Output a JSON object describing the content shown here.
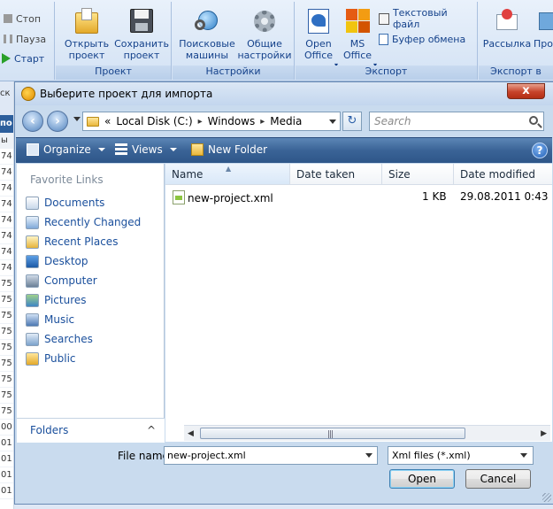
{
  "ribbon": {
    "run_controls": {
      "stop": "Стоп",
      "pause": "Пауза",
      "start": "Старт"
    },
    "groups": {
      "project": {
        "label": "Проект",
        "open_label": "Открыть\nпроект",
        "save_label": "Сохранить\nпроект"
      },
      "settings": {
        "label": "Настройки",
        "search_engines_label": "Поисковые\nмашины",
        "general_settings_label": "Общие\nнастройки"
      },
      "export": {
        "label": "Экспорт",
        "open_office_label": "Open\nOffice",
        "ms_office_label": "MS\nOffice",
        "text_file_label": "Текстовый файл",
        "clipboard_label": "Буфер обмена"
      },
      "export_to": {
        "label": "Экспорт в",
        "mailing_label": "Рассылка",
        "partial_label": "Про"
      }
    }
  },
  "background_list": {
    "partial_header": "ск",
    "partial_tab": "по",
    "partial_col": "ы",
    "cells": [
      "74",
      "74",
      "74",
      "74",
      "74",
      "74",
      "74",
      "74",
      "75",
      "75",
      "75",
      "75",
      "75",
      "75",
      "75",
      "75",
      "75",
      "00",
      "01",
      "01",
      "01",
      "01"
    ]
  },
  "dialog": {
    "title": "Выберите проект для импорта",
    "close_label": "x",
    "address": {
      "prefix": "«",
      "segments": [
        "Local Disk (C:)",
        "Windows",
        "Media"
      ],
      "separator": "▸"
    },
    "refresh_label": "↻",
    "search_placeholder": "Search",
    "toolbar": {
      "organize_label": "Organize",
      "views_label": "Views",
      "new_folder_label": "New Folder",
      "help_label": "?"
    },
    "nav_pane": {
      "heading": "Favorite Links",
      "items": [
        {
          "label": "Documents",
          "icon": "documents-icon"
        },
        {
          "label": "Recently Changed",
          "icon": "recent-changed-icon"
        },
        {
          "label": "Recent Places",
          "icon": "recent-places-icon"
        },
        {
          "label": "Desktop",
          "icon": "desktop-icon"
        },
        {
          "label": "Computer",
          "icon": "computer-icon"
        },
        {
          "label": "Pictures",
          "icon": "pictures-icon"
        },
        {
          "label": "Music",
          "icon": "music-icon"
        },
        {
          "label": "Searches",
          "icon": "searches-icon"
        },
        {
          "label": "Public",
          "icon": "public-icon"
        }
      ],
      "folders_label": "Folders",
      "folders_chevron": "^"
    },
    "file_list": {
      "columns": [
        "Name",
        "Date taken",
        "Size",
        "Date modified"
      ],
      "rows": [
        {
          "name": "new-project.xml",
          "date_taken": "",
          "size": "1 KB",
          "date_modified": "29.08.2011 0:43"
        }
      ]
    },
    "file_name_label": "File name:",
    "file_name_value": "new-project.xml",
    "file_type_value": "Xml files (*.xml)",
    "open_label": "Open",
    "cancel_label": "Cancel"
  },
  "colors": {
    "toolbar": "#3a6396",
    "link": "#1a4f9c",
    "close": "#c7432a",
    "ribbon_text": "#15428b"
  }
}
